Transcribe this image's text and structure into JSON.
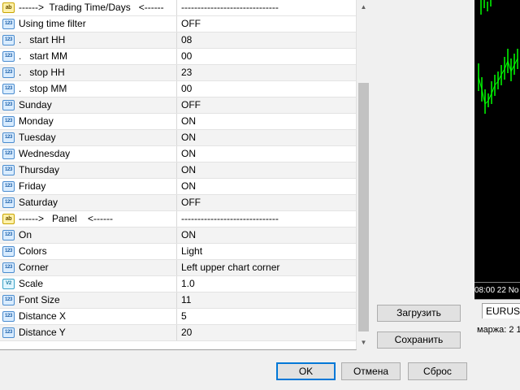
{
  "rows": [
    {
      "icon": "ab",
      "name": "------>  Trading Time/Days   <------",
      "value": "------------------------------"
    },
    {
      "icon": "num",
      "name": "Using time filter",
      "value": "OFF"
    },
    {
      "icon": "num",
      "name": ".   start HH",
      "value": "08"
    },
    {
      "icon": "num",
      "name": ".   start MM",
      "value": "00"
    },
    {
      "icon": "num",
      "name": ".   stop HH",
      "value": "23"
    },
    {
      "icon": "num",
      "name": ".   stop MM",
      "value": "00"
    },
    {
      "icon": "num",
      "name": "Sunday",
      "value": "OFF"
    },
    {
      "icon": "num",
      "name": "Monday",
      "value": "ON"
    },
    {
      "icon": "num",
      "name": "Tuesday",
      "value": "ON"
    },
    {
      "icon": "num",
      "name": "Wednesday",
      "value": "ON"
    },
    {
      "icon": "num",
      "name": "Thursday",
      "value": "ON"
    },
    {
      "icon": "num",
      "name": "Friday",
      "value": "ON"
    },
    {
      "icon": "num",
      "name": "Saturday",
      "value": "OFF"
    },
    {
      "icon": "ab",
      "name": "------>   Panel    <------",
      "value": "------------------------------"
    },
    {
      "icon": "num",
      "name": "On",
      "value": "ON"
    },
    {
      "icon": "num",
      "name": "Colors",
      "value": "Light"
    },
    {
      "icon": "num",
      "name": "Corner",
      "value": "Left upper chart corner"
    },
    {
      "icon": "v",
      "name": "Scale",
      "value": "1.0"
    },
    {
      "icon": "num",
      "name": "Font Size",
      "value": "11"
    },
    {
      "icon": "num",
      "name": "Distance X",
      "value": "5"
    },
    {
      "icon": "num",
      "name": "Distance Y",
      "value": "20"
    }
  ],
  "icon_labels": {
    "num": "123",
    "ab": "ab",
    "v": "V2"
  },
  "icon_names": {
    "num": "numeric-param-icon",
    "ab": "string-param-icon",
    "v": "double-param-icon"
  },
  "buttons": {
    "load": "Загрузить",
    "save": "Сохранить",
    "ok": "OK",
    "cancel": "Отмена",
    "reset": "Сброс"
  },
  "chart": {
    "time_label": "08:00  22 No",
    "symbol_tab": "EURUSD",
    "status_text": "маржа: 2 1",
    "candle_color": "#00ff00"
  }
}
